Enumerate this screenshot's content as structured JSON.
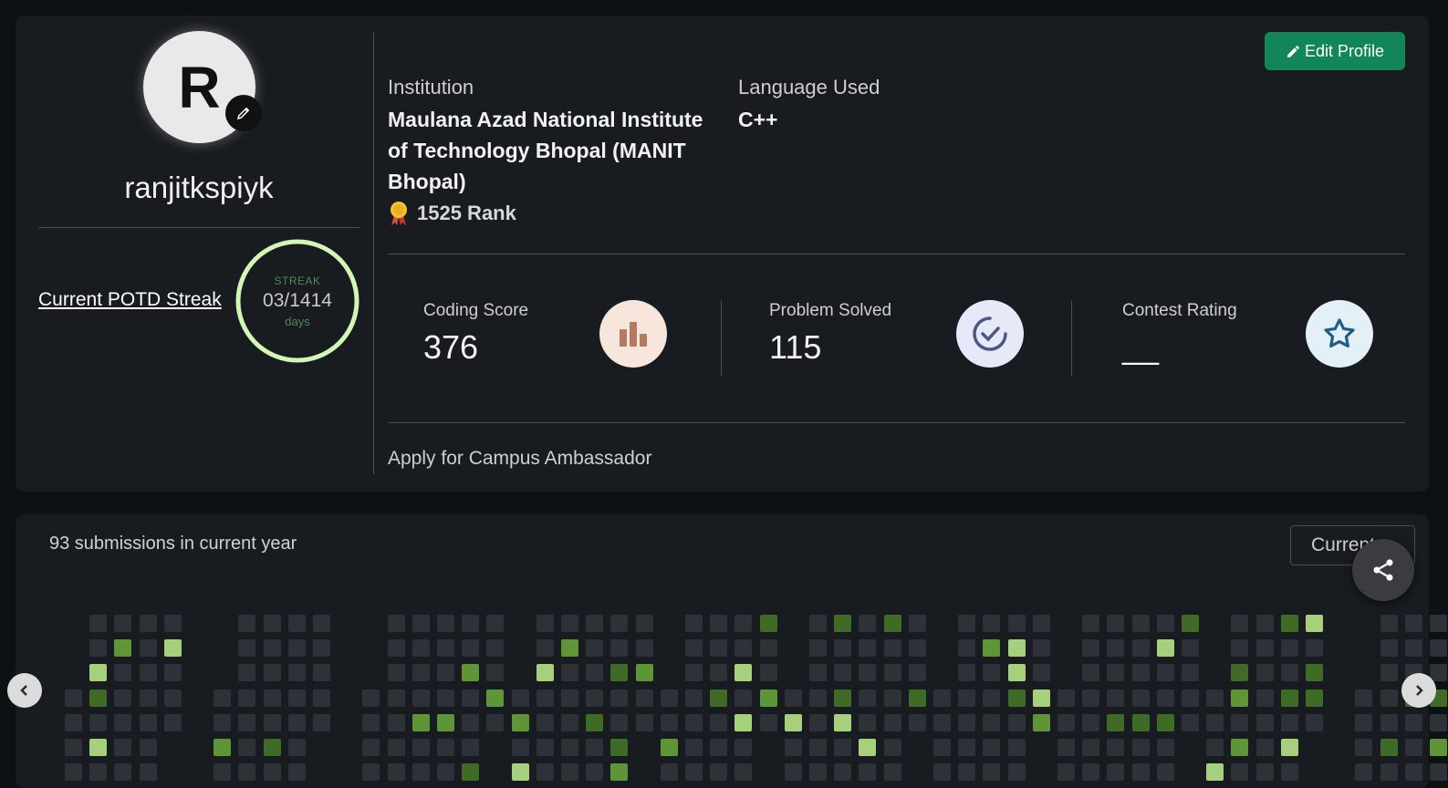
{
  "profile": {
    "avatar_letter": "R",
    "username": "ranjitkspiyk",
    "edit_profile_label": "Edit Profile",
    "institution_label": "Institution",
    "institution_value": "Maulana Azad National Institute of Technology Bhopal (MANIT Bhopal)",
    "language_label": "Language Used",
    "language_value": "C++",
    "rank_text": "1525 Rank"
  },
  "streak": {
    "link_label": "Current POTD Streak",
    "title": "STREAK",
    "value": "03/1414",
    "unit": "days"
  },
  "stats": {
    "coding_score_label": "Coding Score",
    "coding_score_value": "376",
    "problems_solved_label": "Problem Solved",
    "problems_solved_value": "115",
    "contest_rating_label": "Contest Rating",
    "contest_rating_value": "__"
  },
  "campus_ambassador_label": "Apply for Campus Ambassador",
  "heatmap": {
    "submissions_text": "93 submissions in current year",
    "year_select_value": "Current",
    "colors": {
      "empty": "#2d3138",
      "level1": "#3f6b26",
      "level2": "#5e9637",
      "level3": "#a7d07d"
    }
  },
  "colors": {
    "accent_green": "#128559",
    "streak_ring": "#d3f5b5"
  }
}
